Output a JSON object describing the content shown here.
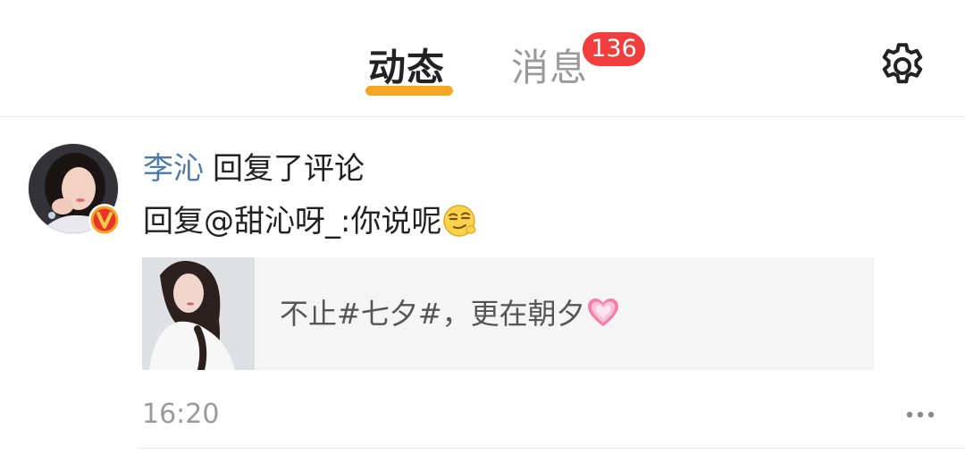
{
  "header": {
    "tabs": [
      {
        "label": "动态",
        "active": true
      },
      {
        "label": "消息",
        "active": false
      }
    ],
    "messages_badge": "136",
    "settings_icon": "gear-icon",
    "accent_color": "#f5a623",
    "badge_color": "#f23d3d"
  },
  "feed": {
    "item": {
      "avatar_icon": "avatar",
      "verified_icon": "verified-v-icon",
      "username": "李沁",
      "action": "回复了评论",
      "reply_text": "回复@甜沁呀_:你说呢",
      "reply_emoji": "smug-face-icon",
      "quote": {
        "thumbnail_icon": "post-thumbnail",
        "text": "不止#七夕#，更在朝夕",
        "emoji": "pink-heart-icon"
      },
      "time": "16:20",
      "more_icon": "more-dots-icon"
    }
  }
}
